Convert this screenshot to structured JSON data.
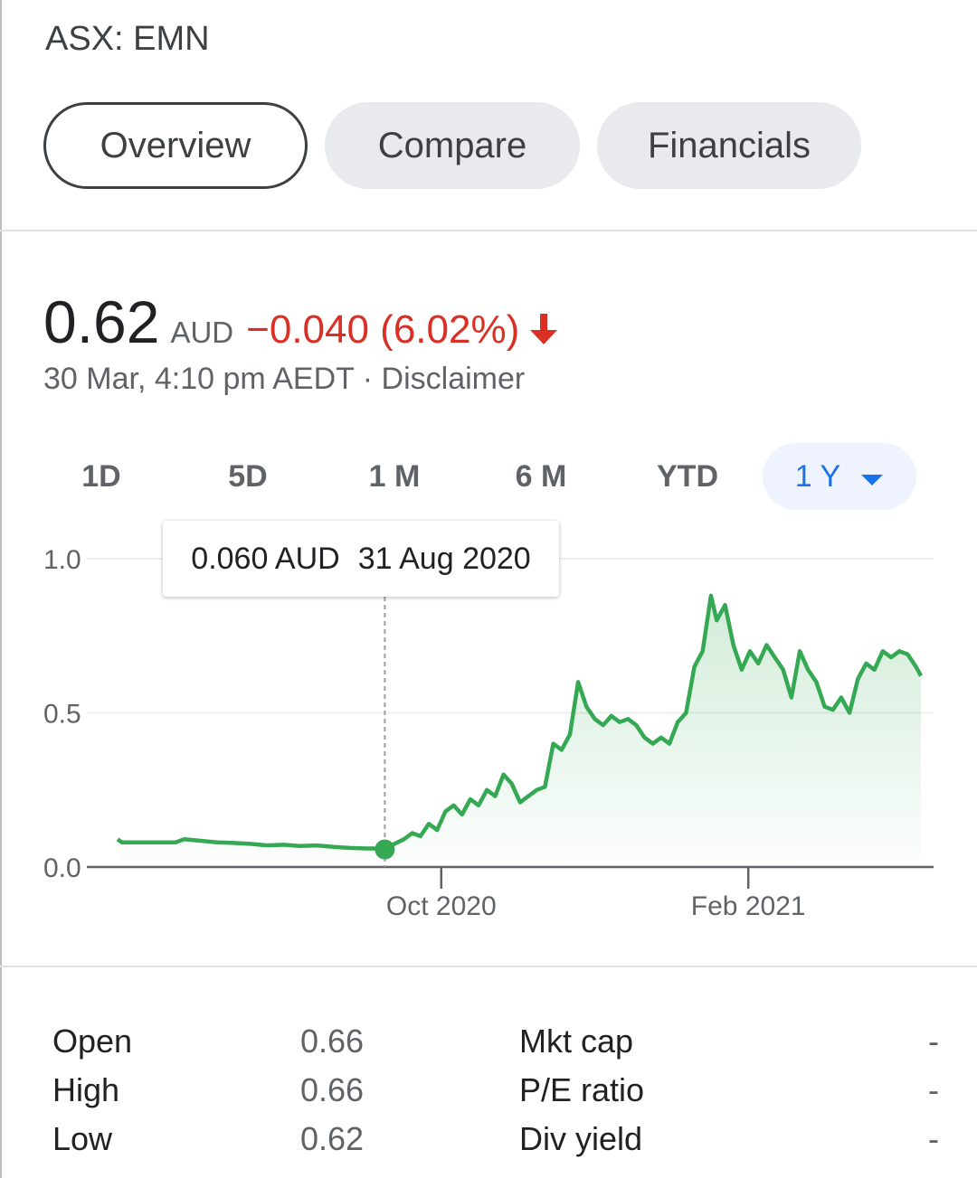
{
  "ticker": "ASX: EMN",
  "tabs": [
    {
      "label": "Overview",
      "active": true
    },
    {
      "label": "Compare",
      "active": false
    },
    {
      "label": "Financials",
      "active": false
    }
  ],
  "quote": {
    "price": "0.62",
    "currency": "AUD",
    "change": "−0.040 (6.02%)",
    "direction": "down",
    "timestamp": "30 Mar, 4:10 pm AEDT · Disclaimer"
  },
  "ranges": [
    {
      "label": "1D",
      "active": false
    },
    {
      "label": "5D",
      "active": false
    },
    {
      "label": "1 M",
      "active": false
    },
    {
      "label": "6 M",
      "active": false
    },
    {
      "label": "YTD",
      "active": false
    },
    {
      "label": "1 Y",
      "active": true
    }
  ],
  "tooltip": {
    "value": "0.060 AUD",
    "date": "31 Aug 2020"
  },
  "colors": {
    "line": "#34a853",
    "down": "#d93025",
    "accent": "#1a73e8"
  },
  "chart_data": {
    "type": "area",
    "title": "",
    "xlabel": "",
    "ylabel": "",
    "ylim": [
      0,
      1.0
    ],
    "yticks": [
      {
        "value": 0,
        "label": "0.0"
      },
      {
        "value": 0.5,
        "label": "0.5"
      },
      {
        "value": 1.0,
        "label": "1.0"
      }
    ],
    "xticks": [
      {
        "value": 0.39,
        "label": "Oct 2020"
      },
      {
        "value": 0.76,
        "label": "Feb 2021"
      }
    ],
    "grid": true,
    "selected_index": 17,
    "series": [
      {
        "values": [
          [
            0.0,
            0.09
          ],
          [
            0.005,
            0.08
          ],
          [
            0.03,
            0.08
          ],
          [
            0.07,
            0.08
          ],
          [
            0.08,
            0.09
          ],
          [
            0.1,
            0.085
          ],
          [
            0.12,
            0.08
          ],
          [
            0.14,
            0.078
          ],
          [
            0.16,
            0.075
          ],
          [
            0.18,
            0.07
          ],
          [
            0.2,
            0.072
          ],
          [
            0.22,
            0.068
          ],
          [
            0.24,
            0.07
          ],
          [
            0.26,
            0.065
          ],
          [
            0.28,
            0.062
          ],
          [
            0.3,
            0.06
          ],
          [
            0.315,
            0.06
          ],
          [
            0.322,
            0.06
          ],
          [
            0.33,
            0.07
          ],
          [
            0.345,
            0.09
          ],
          [
            0.355,
            0.11
          ],
          [
            0.365,
            0.1
          ],
          [
            0.375,
            0.14
          ],
          [
            0.385,
            0.12
          ],
          [
            0.395,
            0.18
          ],
          [
            0.405,
            0.2
          ],
          [
            0.415,
            0.17
          ],
          [
            0.425,
            0.22
          ],
          [
            0.435,
            0.2
          ],
          [
            0.445,
            0.25
          ],
          [
            0.455,
            0.23
          ],
          [
            0.465,
            0.3
          ],
          [
            0.475,
            0.27
          ],
          [
            0.485,
            0.21
          ],
          [
            0.495,
            0.23
          ],
          [
            0.505,
            0.25
          ],
          [
            0.515,
            0.26
          ],
          [
            0.525,
            0.4
          ],
          [
            0.535,
            0.38
          ],
          [
            0.545,
            0.43
          ],
          [
            0.555,
            0.6
          ],
          [
            0.565,
            0.52
          ],
          [
            0.575,
            0.48
          ],
          [
            0.585,
            0.46
          ],
          [
            0.595,
            0.49
          ],
          [
            0.605,
            0.47
          ],
          [
            0.615,
            0.48
          ],
          [
            0.625,
            0.46
          ],
          [
            0.635,
            0.42
          ],
          [
            0.645,
            0.4
          ],
          [
            0.655,
            0.42
          ],
          [
            0.665,
            0.4
          ],
          [
            0.675,
            0.47
          ],
          [
            0.685,
            0.5
          ],
          [
            0.695,
            0.65
          ],
          [
            0.705,
            0.7
          ],
          [
            0.715,
            0.88
          ],
          [
            0.722,
            0.8
          ],
          [
            0.732,
            0.85
          ],
          [
            0.742,
            0.72
          ],
          [
            0.752,
            0.64
          ],
          [
            0.762,
            0.7
          ],
          [
            0.772,
            0.66
          ],
          [
            0.782,
            0.72
          ],
          [
            0.792,
            0.68
          ],
          [
            0.802,
            0.64
          ],
          [
            0.812,
            0.55
          ],
          [
            0.822,
            0.7
          ],
          [
            0.832,
            0.64
          ],
          [
            0.842,
            0.6
          ],
          [
            0.852,
            0.52
          ],
          [
            0.862,
            0.51
          ],
          [
            0.872,
            0.55
          ],
          [
            0.882,
            0.5
          ],
          [
            0.892,
            0.61
          ],
          [
            0.902,
            0.66
          ],
          [
            0.912,
            0.64
          ],
          [
            0.922,
            0.7
          ],
          [
            0.932,
            0.68
          ],
          [
            0.942,
            0.7
          ],
          [
            0.952,
            0.69
          ],
          [
            0.962,
            0.65
          ],
          [
            0.968,
            0.62
          ]
        ]
      }
    ]
  },
  "stats": [
    {
      "label": "Open",
      "value": "0.66"
    },
    {
      "label": "High",
      "value": "0.66"
    },
    {
      "label": "Low",
      "value": "0.62"
    },
    {
      "label": "Mkt cap",
      "value": "-"
    },
    {
      "label": "P/E ratio",
      "value": "-"
    },
    {
      "label": "Div yield",
      "value": "-"
    }
  ]
}
